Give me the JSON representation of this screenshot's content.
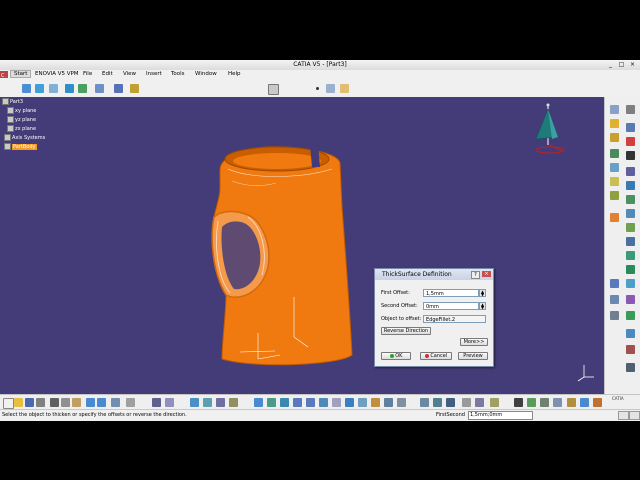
{
  "window": {
    "title": "CATIA V5 - [Part3]",
    "minimize": "_",
    "restore": "□",
    "close": "×"
  },
  "menubar": {
    "items": [
      "Start",
      "ENOVIA V5 VPM",
      "File",
      "Edit",
      "View",
      "Insert",
      "Tools",
      "Window",
      "Help"
    ]
  },
  "tree": {
    "root": "Part3",
    "items": [
      "xy plane",
      "yz plane",
      "zx plane",
      "Axis Systems",
      "PartBody"
    ],
    "selected": "PartBody"
  },
  "dialog": {
    "title": "ThickSurface Definition",
    "help": "?",
    "close": "×",
    "first_offset_label": "First Offset:",
    "first_offset_value": "1,5mm",
    "second_offset_label": "Second Offset:",
    "second_offset_value": "0mm",
    "object_label": "Object to offset:",
    "object_value": "EdgeFillet.2",
    "reverse_button": "Reverse Direction",
    "more_button": "More>>",
    "ok_button": "OK",
    "cancel_button": "Cancel",
    "preview_button": "Preview"
  },
  "statusbar": {
    "message": "Select the object to thicken or specify the offsets or reverse the direction.",
    "field_label": "FirstSecond",
    "field_value": "1,5mm;0mm"
  },
  "colors": {
    "viewport": "#443c78",
    "part": "#f07a10",
    "selection": "#f79a25"
  },
  "compass_label": "CATIA"
}
